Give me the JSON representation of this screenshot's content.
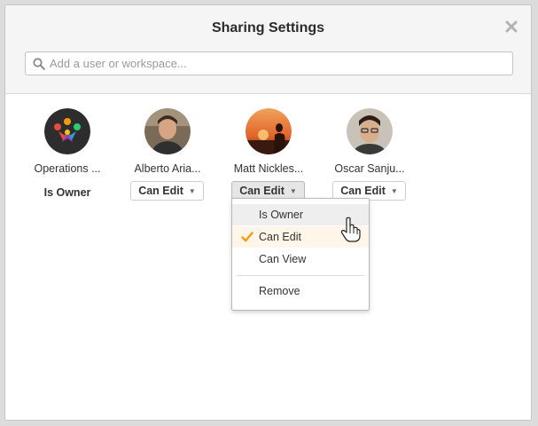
{
  "dialog": {
    "title": "Sharing Settings",
    "close_icon": "close-icon"
  },
  "search": {
    "placeholder": "Add a user or workspace...",
    "value": "",
    "icon": "search-icon"
  },
  "members": [
    {
      "name": "Operations ...",
      "role": "Is Owner",
      "avatar": "workspace-logo-icon"
    },
    {
      "name": "Alberto Aria...",
      "role": "Can Edit",
      "avatar": "user-photo"
    },
    {
      "name": "Matt Nickles...",
      "role": "Can Edit",
      "avatar": "user-photo-sunset"
    },
    {
      "name": "Oscar Sanju...",
      "role": "Can Edit",
      "avatar": "user-photo"
    }
  ],
  "dropdown": {
    "open": true,
    "items": [
      {
        "label": "Is Owner",
        "state": "hover"
      },
      {
        "label": "Can Edit",
        "state": "selected"
      },
      {
        "label": "Can View",
        "state": ""
      }
    ],
    "remove_label": "Remove",
    "check_icon": "checkmark-icon"
  },
  "colors": {
    "accent_orange": "#f39c12",
    "header_bg": "#f5f5f5",
    "selected_row_bg": "#fff5e8"
  }
}
